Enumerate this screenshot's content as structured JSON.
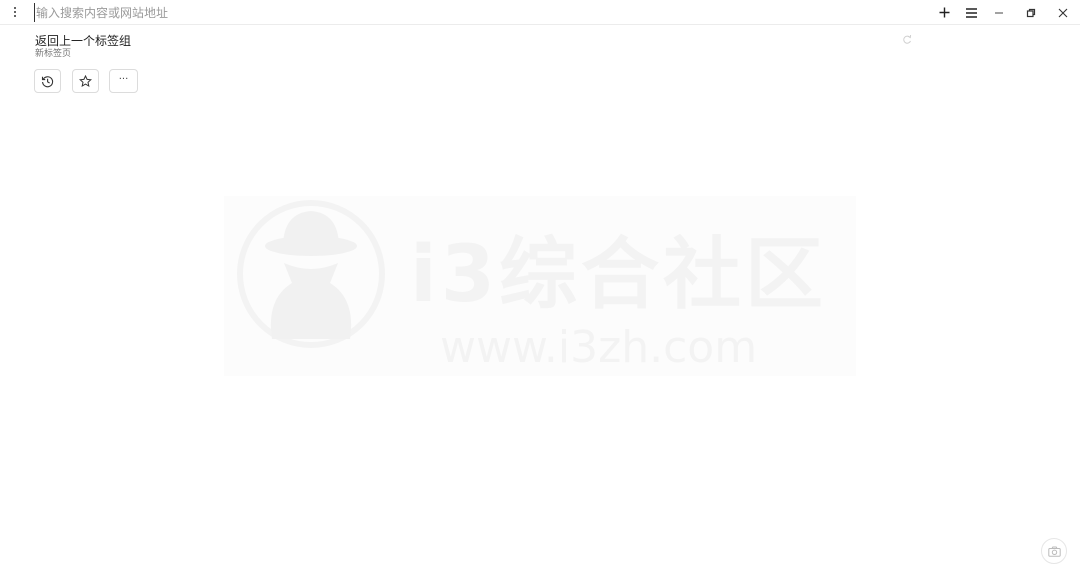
{
  "address_bar": {
    "placeholder": "输入搜索内容或网站地址",
    "value": ""
  },
  "window_controls": {
    "new_tab": "new-tab-icon",
    "menu": "menu-icon",
    "minimize": "minimize-icon",
    "restore": "restore-icon",
    "close": "close-icon"
  },
  "tab_group": {
    "title": "返回上一个标签组",
    "subtitle": "新标签页"
  },
  "actions": {
    "history": "history-icon",
    "favorite": "star-icon",
    "more_label": "···"
  },
  "watermark": {
    "text": "i3综合社区",
    "url": "www.i3zh.com"
  }
}
